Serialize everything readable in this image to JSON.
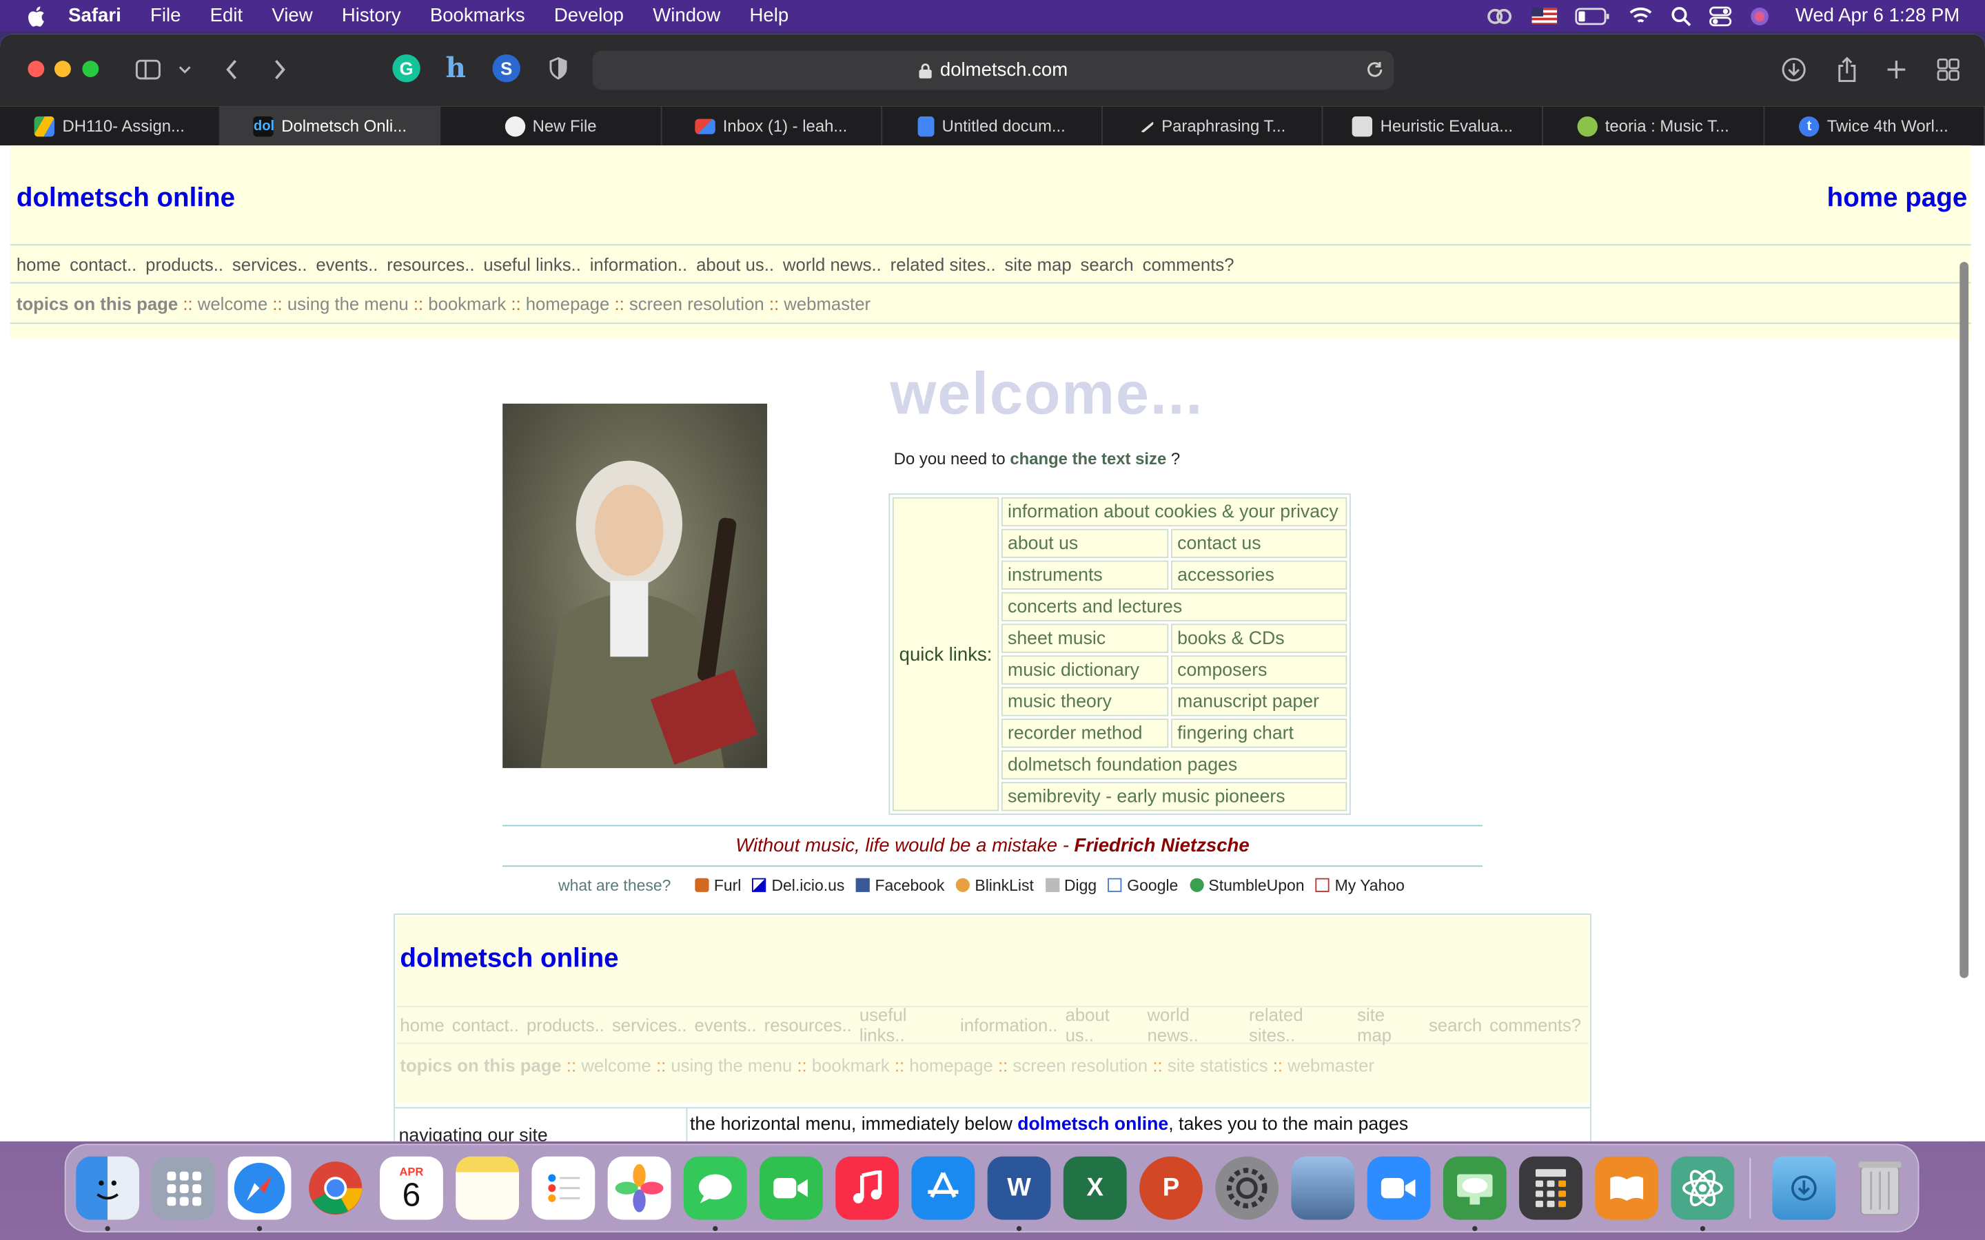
{
  "menubar": {
    "app": "Safari",
    "items": [
      "File",
      "Edit",
      "View",
      "History",
      "Bookmarks",
      "Develop",
      "Window",
      "Help"
    ],
    "clock": "Wed Apr 6  1:28 PM"
  },
  "browser": {
    "url": "dolmetsch.com",
    "tabs": [
      {
        "label": "DH110- Assign...",
        "color": "#34a853"
      },
      {
        "label": "Dolmetsch Onli...",
        "color": "#0000e0"
      },
      {
        "label": "New File",
        "color": "#f0f0f0"
      },
      {
        "label": "Inbox (1) - leah...",
        "color": "#ea4335"
      },
      {
        "label": "Untitled docum...",
        "color": "#4285f4"
      },
      {
        "label": "Paraphrasing T...",
        "color": "#dddddd"
      },
      {
        "label": "Heuristic Evalua...",
        "color": "#bbbbbb"
      },
      {
        "label": "teoria : Music T...",
        "color": "#8bc34a"
      },
      {
        "label": "Twice 4th Worl...",
        "color": "#3d7bf0"
      }
    ]
  },
  "header": {
    "site_title": "dolmetsch online",
    "home_link": "home page",
    "nav": [
      "home",
      "contact..",
      "products..",
      "services..",
      "events..",
      "resources..",
      "useful links..",
      "information..",
      "about us..",
      "world news..",
      "related sites..",
      "site map",
      "search",
      "comments?"
    ],
    "topics_label": "topics on this page",
    "topics": [
      "welcome",
      "using the menu",
      "bookmark",
      "homepage",
      "screen resolution",
      "webmaster"
    ]
  },
  "main": {
    "welcome": "welcome...",
    "textsize_prefix": "Do you need to ",
    "textsize_link": "change the text size",
    "textsize_suffix": " ?",
    "quick_links_label": "quick links:",
    "quick_links": {
      "privacy": "information about cookies & your privacy",
      "about": "about us",
      "contact": "contact us",
      "instruments": "instruments",
      "accessories": "accessories",
      "concerts": "concerts and lectures",
      "sheet_music": "sheet music",
      "books": "books & CDs",
      "dictionary": "music dictionary",
      "composers": "composers",
      "theory": "music theory",
      "manuscript": "manuscript paper",
      "recorder": "recorder method",
      "fingering": "fingering chart",
      "foundation": "dolmetsch foundation pages",
      "semibrevity": "semibrevity - early music pioneers"
    },
    "quote_text": "Without music, life would be a mistake - ",
    "quote_author": "Friedrich Nietzsche",
    "social_prompt": "what are these?",
    "social": [
      {
        "label": "Furl",
        "color": "#d2691e"
      },
      {
        "label": "Del.icio.us",
        "color": "#0000cc"
      },
      {
        "label": "Facebook",
        "color": "#3b5998"
      },
      {
        "label": "BlinkList",
        "color": "#e8a040"
      },
      {
        "label": "Digg",
        "color": "#888888"
      },
      {
        "label": "Google",
        "color": "#4a7ad0"
      },
      {
        "label": "StumbleUpon",
        "color": "#3aa050"
      },
      {
        "label": "My Yahoo",
        "color": "#c03030"
      }
    ]
  },
  "frame2": {
    "site_title": "dolmetsch online",
    "nav": [
      "home",
      "contact..",
      "products..",
      "services..",
      "events..",
      "resources..",
      "useful links..",
      "information..",
      "about us..",
      "world news..",
      "related sites..",
      "site map",
      "search",
      "comments?"
    ],
    "topics_label": "topics on this page",
    "topics": [
      "welcome",
      "using the menu",
      "bookmark",
      "homepage",
      "screen resolution",
      "site statistics",
      "webmaster"
    ],
    "cell_left": "navigating our site",
    "cell_right_prefix": "the horizontal menu, immediately below ",
    "cell_right_link": "dolmetsch online",
    "cell_right_suffix": ", takes you to the main pages"
  },
  "dock": {
    "apps": [
      {
        "name": "finder",
        "color": "#3a8ee8"
      },
      {
        "name": "launchpad",
        "color": "#9aa4b4"
      },
      {
        "name": "safari",
        "color": "#2a8af0"
      },
      {
        "name": "chrome",
        "color": "#e8e8e8"
      },
      {
        "name": "calendar",
        "color": "#ffffff"
      },
      {
        "name": "notes",
        "color": "#f8d85a"
      },
      {
        "name": "reminders",
        "color": "#f4f4f4"
      },
      {
        "name": "photos",
        "color": "#f2f2f2"
      },
      {
        "name": "messages",
        "color": "#34c759"
      },
      {
        "name": "facetime",
        "color": "#30c050"
      },
      {
        "name": "music",
        "color": "#fa2d48"
      },
      {
        "name": "app-store",
        "color": "#1a8af0"
      },
      {
        "name": "word",
        "color": "#2b579a"
      },
      {
        "name": "excel",
        "color": "#217346"
      },
      {
        "name": "powerpoint",
        "color": "#d24726"
      },
      {
        "name": "system-preferences",
        "color": "#8a8a8e"
      },
      {
        "name": "preview",
        "color": "#6a90c0"
      },
      {
        "name": "zoom",
        "color": "#2d8cff"
      },
      {
        "name": "screen-share",
        "color": "#3a9a48"
      },
      {
        "name": "calculator",
        "color": "#3a3a3c"
      },
      {
        "name": "books",
        "color": "#f08a24"
      },
      {
        "name": "atom",
        "color": "#4aa88a"
      },
      {
        "name": "downloads",
        "color": "#4aa0e0"
      },
      {
        "name": "trash",
        "color": "#c8c8cc"
      }
    ],
    "calendar_month": "APR",
    "calendar_day": "6"
  }
}
